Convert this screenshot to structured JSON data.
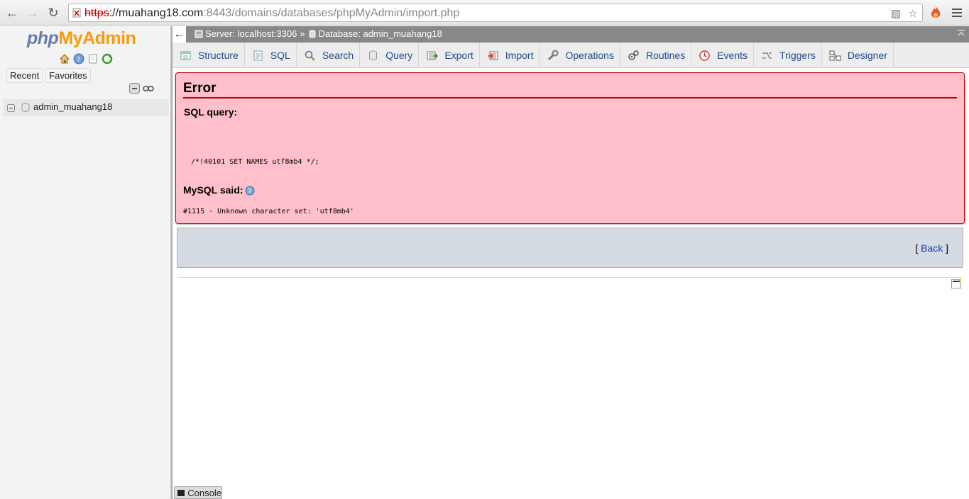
{
  "browser": {
    "url_scheme": "https",
    "url_rest": "://muahang18.com",
    "url_port": ":8443",
    "url_path": "/domains/databases/phpMyAdmin/import.php"
  },
  "left_panel": {
    "logo_php": "php",
    "logo_my": "My",
    "logo_admin": "Admin",
    "tabs": [
      "Recent",
      "Favorites"
    ],
    "databases": [
      "admin_muahang18"
    ]
  },
  "breadcrumb": {
    "server": "Server: localhost:3306",
    "separator": "»",
    "database": "Database: admin_muahang18"
  },
  "tabs": [
    {
      "label": "Structure",
      "icon": "structure-icon"
    },
    {
      "label": "SQL",
      "icon": "sql-icon"
    },
    {
      "label": "Search",
      "icon": "search-icon"
    },
    {
      "label": "Query",
      "icon": "query-icon"
    },
    {
      "label": "Export",
      "icon": "export-icon"
    },
    {
      "label": "Import",
      "icon": "import-icon"
    },
    {
      "label": "Operations",
      "icon": "wrench-icon"
    },
    {
      "label": "Routines",
      "icon": "routines-icon"
    },
    {
      "label": "Events",
      "icon": "clock-icon"
    },
    {
      "label": "Triggers",
      "icon": "triggers-icon"
    },
    {
      "label": "Designer",
      "icon": "designer-icon"
    }
  ],
  "error": {
    "title": "Error",
    "sql_query_label": "SQL query:",
    "sql_query": "/*!40101 SET NAMES utf8mb4 */;",
    "mysql_said_label": "MySQL said:",
    "message": "#1115 - Unknown character set: 'utf8mb4'"
  },
  "back": {
    "open": "[ ",
    "label": "Back",
    "close": " ]"
  },
  "console": {
    "label": "Console"
  },
  "colors": {
    "error_bg": "#ffc0cb",
    "error_border": "#cc0000",
    "link": "#2337b3",
    "logo_blue": "#6c78af",
    "logo_orange": "#f89c0e"
  }
}
